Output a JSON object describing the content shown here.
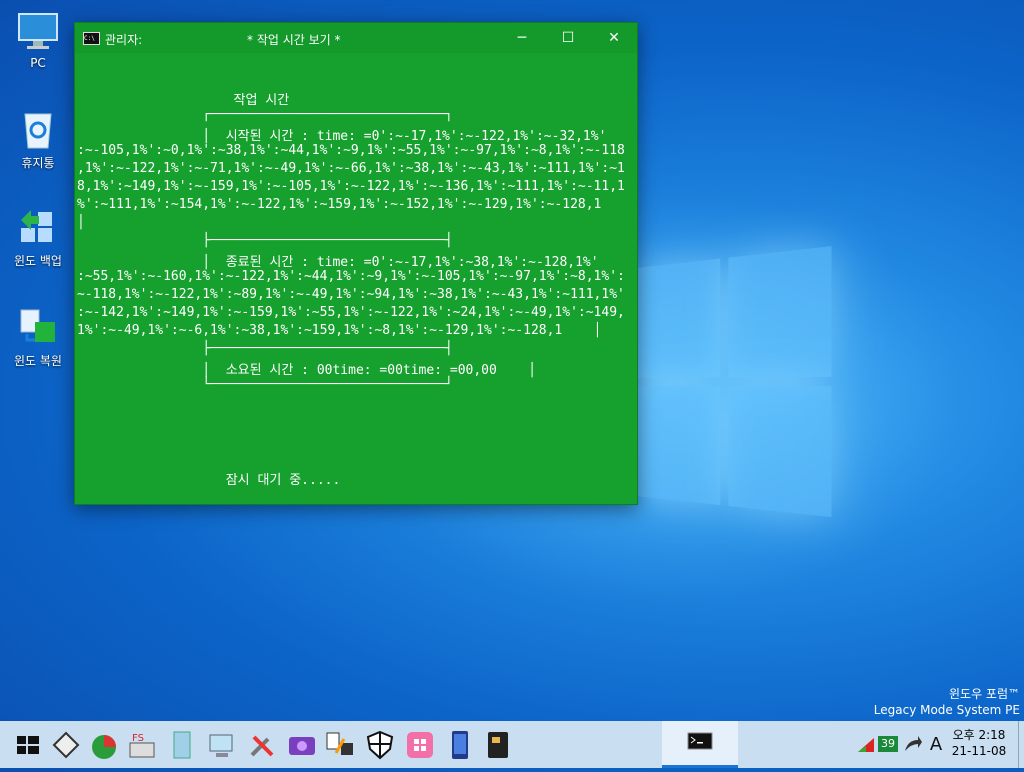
{
  "desktop": {
    "icons": [
      {
        "label": "PC"
      },
      {
        "label": "휴지통"
      },
      {
        "label": "윈도 백업"
      },
      {
        "label": "윈도 복원"
      }
    ]
  },
  "window": {
    "user_label": "관리자:",
    "title": "* 작업 시간 보기 *",
    "console_lines": [
      "                    작업 시간",
      "                ┌──────────────────────────────┐",
      "                │  시작된 시간 : time: =0':~-17,1%':~-122,1%':~-32,1%'",
      ":~-105,1%':~0,1%':~38,1%':~44,1%':~9,1%':~55,1%':~-97,1%':~8,1%':~-118",
      ",1%':~-122,1%':~-71,1%':~-49,1%':~-66,1%':~38,1%':~-43,1%':~111,1%':~1",
      "8,1%':~149,1%':~-159,1%':~-105,1%':~-122,1%':~-136,1%':~111,1%':~-11,1",
      "%':~111,1%':~154,1%':~-122,1%':~159,1%':~-152,1%':~-129,1%':~-128,1",
      "│",
      "                ├──────────────────────────────┤",
      "                │  종료된 시간 : time: =0':~-17,1%':~38,1%':~-128,1%'",
      ":~55,1%':~-160,1%':~-122,1%':~44,1%':~9,1%':~-105,1%':~-97,1%':~8,1%':",
      "~-118,1%':~-122,1%':~89,1%':~-49,1%':~94,1%':~38,1%':~-43,1%':~111,1%'",
      ":~-142,1%':~149,1%':~-159,1%':~55,1%':~-122,1%':~24,1%':~-49,1%':~149,",
      "1%':~-49,1%':~-6,1%':~38,1%':~159,1%':~8,1%':~-129,1%':~-128,1    │",
      "                ├──────────────────────────────┤",
      "                │  소요된 시간 : 00time: =00time: =00,00    │",
      "                └──────────────────────────────┘",
      "                   잠시 대기 중....."
    ]
  },
  "watermark": {
    "line1": "윈도우 포럼™",
    "line2": "Legacy Mode System PE"
  },
  "taskbar": {
    "tray_badge": "39",
    "ime_label": "A",
    "clock_time": "오후 2:18",
    "clock_date": "21-11-08"
  },
  "colors": {
    "console_bg": "#16a12f",
    "taskbar_bg": "#c9def0",
    "desktop_accent": "#1f86e0"
  }
}
